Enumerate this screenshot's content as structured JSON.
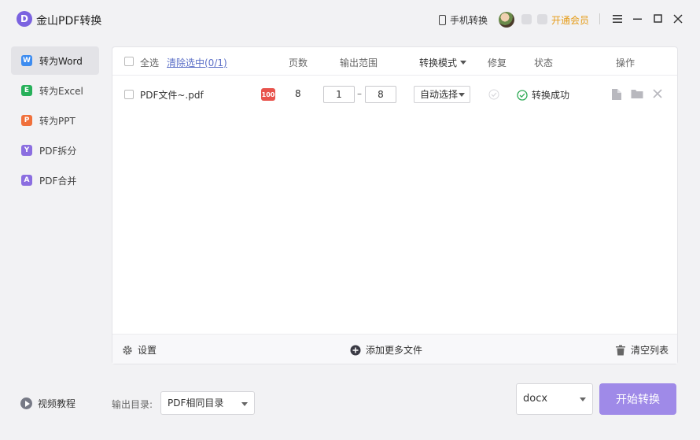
{
  "app": {
    "logo_letter": "D",
    "title": "金山PDF转换"
  },
  "titlebar": {
    "mobile_convert_label": "手机转换",
    "vip_label": "开通会员",
    "icons": [
      "phone-icon",
      "avatar",
      "badge-icon",
      "menu-icon",
      "minimize-icon",
      "maximize-icon",
      "close-icon"
    ]
  },
  "sidebar": {
    "items": [
      {
        "label": "转为Word",
        "icon": "word-icon",
        "icon_letter": "W",
        "color": "#3d8cf0",
        "active": true
      },
      {
        "label": "转为Excel",
        "icon": "excel-icon",
        "icon_letter": "E",
        "color": "#27b05a",
        "active": false
      },
      {
        "label": "转为PPT",
        "icon": "ppt-icon",
        "icon_letter": "P",
        "color": "#f0703b",
        "active": false
      },
      {
        "label": "PDF拆分",
        "icon": "split-icon",
        "icon_letter": "Y",
        "color": "#8b6ee0",
        "active": false
      },
      {
        "label": "PDF合并",
        "icon": "merge-icon",
        "icon_letter": "A",
        "color": "#8b6ee0",
        "active": false
      }
    ]
  },
  "table": {
    "headers": {
      "select_all": "全选",
      "clear_selection": "清除选中(0/1)",
      "pages": "页数",
      "output_range": "输出范围",
      "convert_mode": "转换模式",
      "repair": "修复",
      "status": "状态",
      "actions": "操作"
    },
    "rows": [
      {
        "filename": "PDF文件~.pdf",
        "badge": "100",
        "pages": "8",
        "range_from": "1",
        "range_sep": "–",
        "range_to": "8",
        "mode": "自动选择",
        "status": "转换成功"
      }
    ]
  },
  "panel_footer": {
    "settings_label": "设置",
    "add_files_label": "添加更多文件",
    "clear_list_label": "清空列表"
  },
  "bottom": {
    "tutorial_label": "视频教程",
    "output_dir_label": "输出目录:",
    "output_dir_value": "PDF相同目录",
    "format_value": "docx",
    "start_button": "开始转换"
  },
  "colors": {
    "accent": "#9f8ae8",
    "vip": "#e59b16",
    "success": "#2eaa55",
    "link": "#5b6fc7"
  }
}
